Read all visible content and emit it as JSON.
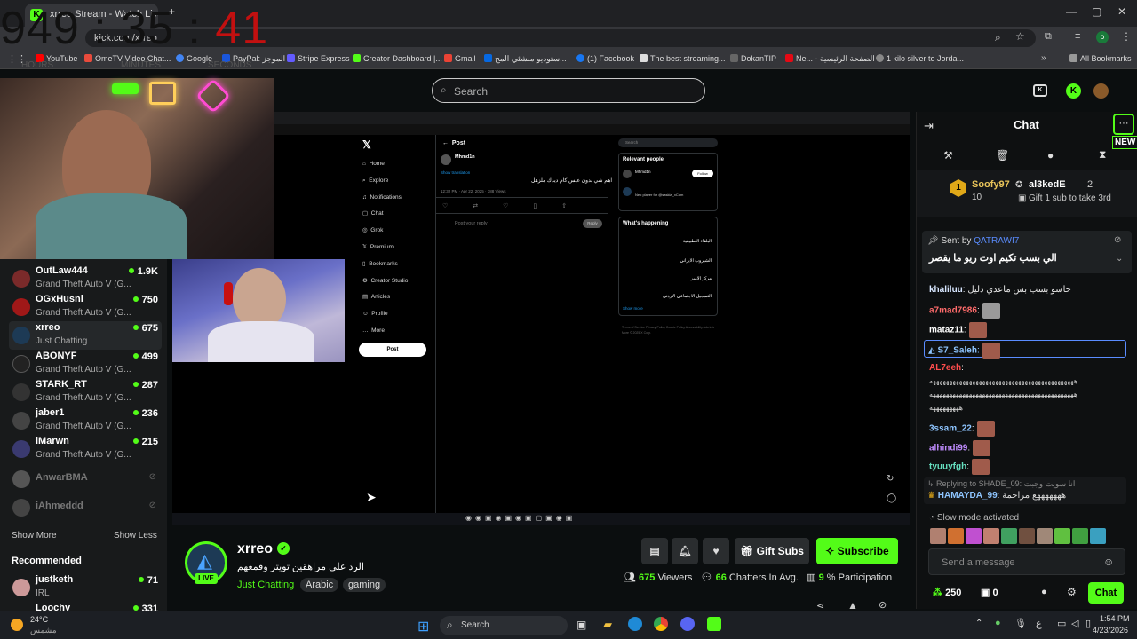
{
  "browser": {
    "tab_title": "xrreo Stream - Watch Live",
    "url": "kick.com/xrreo",
    "bookmarks": [
      "YouTube",
      "OmeTV Video Chat...",
      "Google",
      "PayPal: الموجز",
      "Stripe Express",
      "Creator Dashboard |...",
      "Gmail",
      "ستوديو منشئي المح...",
      "(1) Facebook",
      "The best streaming...",
      "DokanTIP",
      "Ne... - الصفحة الرئيسية",
      "1 kilo silver to Jorda..."
    ],
    "all_bookmarks": "All Bookmarks"
  },
  "overlay_clock": {
    "digits": "949 : 35 : ",
    "seconds": "41",
    "labels": [
      "HOURS",
      "MINUTES",
      "SECONDS"
    ]
  },
  "header": {
    "search_placeholder": "Search"
  },
  "sidebar": {
    "channels": [
      {
        "name": "OutLaw444",
        "game": "Grand Theft Auto V (G...",
        "viewers": "1.9K",
        "color": "#7a2a2a"
      },
      {
        "name": "OGxHusni",
        "game": "Grand Theft Auto V (G...",
        "viewers": "750",
        "color": "#a01818"
      },
      {
        "name": "xrreo",
        "game": "Just Chatting",
        "viewers": "675",
        "color": "#1d3a55"
      },
      {
        "name": "ABONYF",
        "game": "Grand Theft Auto V (G...",
        "viewers": "499",
        "color": "#222"
      },
      {
        "name": "STARK_RT",
        "game": "Grand Theft Auto V (G...",
        "viewers": "287",
        "color": "#333"
      },
      {
        "name": "jaber1",
        "game": "Grand Theft Auto V (G...",
        "viewers": "236",
        "color": "#444"
      },
      {
        "name": "iMarwn",
        "game": "Grand Theft Auto V (G...",
        "viewers": "215",
        "color": "#3a3a70"
      },
      {
        "name": "AnwarBMA",
        "game": "",
        "viewers": "",
        "color": "#555"
      },
      {
        "name": "iAhmeddd",
        "game": "",
        "viewers": "",
        "color": "#444"
      }
    ],
    "show_more": "Show More",
    "show_less": "Show Less",
    "recommended_title": "Recommended",
    "recommended": [
      {
        "name": "justketh",
        "game": "IRL",
        "viewers": "71"
      },
      {
        "name": "Loochy",
        "game": "",
        "viewers": "331"
      }
    ]
  },
  "xpage": {
    "nav": [
      "Home",
      "Explore",
      "Notifications",
      "Chat",
      "Grok",
      "Premium",
      "Bookmarks",
      "Creator Studio",
      "Articles",
      "Profile",
      "More"
    ],
    "post_button": "Post",
    "post_title": "Post",
    "author": "Mhmd1n",
    "post_text": "اهم شي بدون عيس كام ديدك ملزهل",
    "show_translation": "Show translation",
    "meta": "12:32 PM · Apr 22, 2025 · 388 Views",
    "reply_placeholder": "Post your reply",
    "reply_btn": "Reply",
    "search_placeholder": "Search",
    "relevant_title": "Relevant people",
    "follow": "Follow",
    "rel_bio": "Neo player for @saskia_xCom",
    "whats_title": "What's happening",
    "trends": [
      "البلقاء التطبيقية",
      "الشيروب الايراني",
      "مركز الامير",
      "التسجيل الاجتماعي الاردني"
    ],
    "show_more": "Show more",
    "footer": "Terms of Service  Privacy Policy  Cookie Policy  Accessibility  Ads info  More  © 2025 X Corp."
  },
  "stream": {
    "channel_name": "xrreo",
    "title": "الرد على مراهقين تويتر وقمعهم",
    "category": "Just Chatting",
    "tags": [
      "Arabic",
      "gaming"
    ],
    "live_label": "LIVE",
    "gift_subs": "Gift Subs",
    "subscribe": "Subscribe",
    "viewers": "675",
    "viewers_label": "Viewers",
    "chatters": "66",
    "chatters_label": "Chatters In Avg.",
    "participation": "9",
    "participation_label": "% Participation"
  },
  "chat": {
    "title": "Chat",
    "new_badge": "NEW",
    "leader_name": "Soofy97",
    "leader_rank": "1",
    "leader_points": "10",
    "second_name": "al3kedE",
    "second_rank": "2",
    "second_note": "Gift 1 sub to take 3rd",
    "pinned_by_label": "Sent by",
    "pinned_by": "QATRAWI7",
    "pinned_text": "الي بسب تكيم اوت ريو ما يقصر",
    "messages": [
      {
        "user": "khaliluu",
        "color": "#d7e6ff",
        "text": "حاسو بسب بس ماعدي دليل",
        "emotes": 0
      },
      {
        "user": "a7mad7986",
        "color": "#ff6b6b",
        "text": "",
        "emotes": 1
      },
      {
        "user": "mataz11",
        "color": "#ffffff",
        "text": "",
        "emotes": 1
      },
      {
        "user": "S7_Saleh",
        "color": "#8ec5ff",
        "text": "",
        "emotes": 1
      },
      {
        "user": "AL7eeh",
        "color": "#ff4d4d",
        "text": "",
        "emotes": 0
      },
      {
        "user": "3ssam_22",
        "color": "#8ec5ff",
        "text": "",
        "emotes": 1
      },
      {
        "user": "alhindi99",
        "color": "#c08cff",
        "text": "",
        "emotes": 1
      },
      {
        "user": "tyuuyfgh",
        "color": "#66e0c0",
        "text": "",
        "emotes": 1
      }
    ],
    "long_text_1": "ههههههههههههههههههههههههههههههههههههههههههههه",
    "long_text_2": "ههههههههههههههههههههههههههههههههههههههههههههه",
    "long_text_3": "هههههههههه",
    "reply_to": "Replying to SHADE_09:",
    "reply_preview": "انا سويت وجبت",
    "reply_user": "HAMAYDA_99",
    "reply_text": "هههههههع مراحمة",
    "slow_mode": "Slow mode activated",
    "input_placeholder": "Send a message",
    "points": "250",
    "gifts": "0",
    "chat_button": "Chat"
  },
  "taskbar": {
    "weather_temp": "24°C",
    "weather_desc": "مشمس",
    "search": "Search",
    "time": "1:54 PM",
    "date": "4/23/2026",
    "lang": "ع"
  }
}
